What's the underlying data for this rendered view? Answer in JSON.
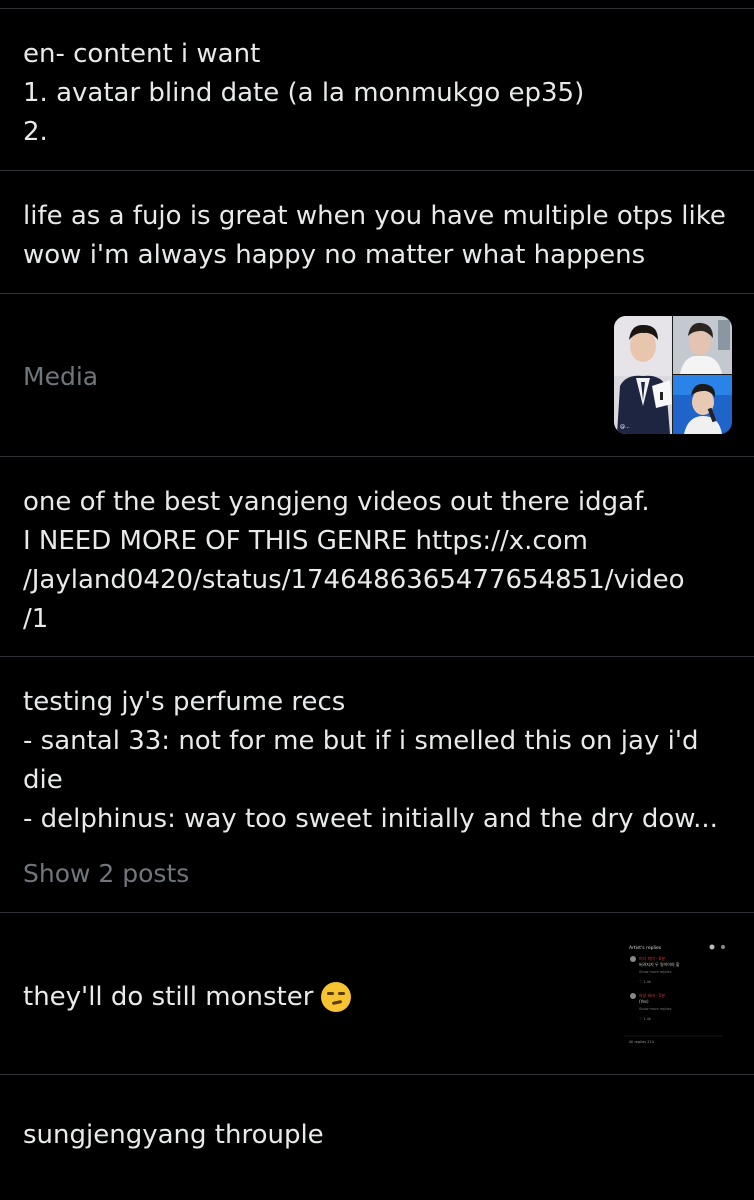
{
  "notes": [
    {
      "lines": [
        "en- content i want",
        "1. avatar blind date (a la monmukgo ep35)",
        "2."
      ]
    },
    {
      "lines": [
        "life as a fujo is great when you have multiple otps like",
        "wow i'm always happy no matter what happens"
      ]
    },
    {
      "label": "Media",
      "thumbnail": "photo-collage-thumbnail"
    },
    {
      "lines": [
        "one of the best yangjeng videos out there idgaf.",
        "I NEED MORE OF THIS GENRE https://x.com",
        "/Jayland0420/status/1746486365477654851/video",
        "/1"
      ]
    },
    {
      "lines": [
        "testing jy's perfume recs",
        "- santal 33: not for me but if i smelled this on jay i'd",
        "die",
        "- delphinus: way too sweet initially and the dry dow..."
      ],
      "show_more": "Show 2 posts"
    },
    {
      "text": "they'll do still monster",
      "emoji": "smirking-face-emoji",
      "thumbnail": "screenshot-thumbnail",
      "thumbnail_text": {
        "header": "Artist's replies",
        "reply1_line1": "미디·미미 · 6분",
        "reply1_line2": "버려지지 두 명이어야 할",
        "reply1_more": "Show more replies",
        "reply1_likes": "♡ 1.4k",
        "reply2_line1": "아앙 비비 · 5분",
        "reply2_line2": "(Yes)",
        "reply2_more": "Show more replies",
        "reply2_likes": "♡ 1.4k",
        "footer": "All replies 214"
      }
    },
    {
      "lines": [
        "sungjengyang throuple"
      ]
    }
  ]
}
